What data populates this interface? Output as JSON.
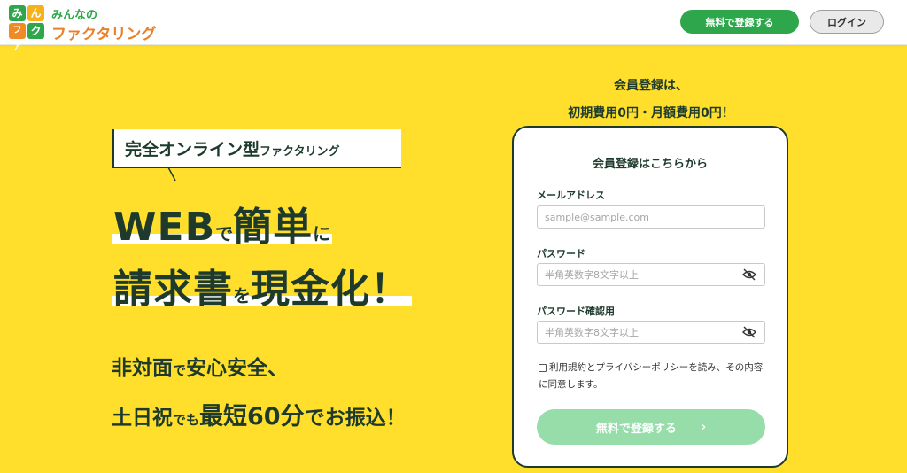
{
  "header": {
    "logo": {
      "tiles": [
        "み",
        "ん",
        "ファ",
        "ク"
      ],
      "small_text": "みんなの",
      "big_text": "ファクタリング"
    },
    "register_button": "無料で登録する",
    "login_button": "ログイン"
  },
  "hero": {
    "badge_main": "完全オンライン型",
    "badge_sub": "ファクタリング",
    "line1": {
      "a": "WEB",
      "b": "で",
      "c": "簡単",
      "d": "に"
    },
    "line2": {
      "a": "請求書",
      "b": "を",
      "c": "現金化！"
    },
    "sub1": {
      "a": "非対面",
      "b": "で",
      "c": "安心安全、"
    },
    "sub2": {
      "a": "土日祝",
      "b": "でも",
      "c": "最短60分",
      "d": "でお振込！"
    }
  },
  "promo": {
    "line1": "会員登録は、",
    "line2": "初期費用0円・月額費用0円！"
  },
  "form": {
    "title": "会員登録はこちらから",
    "email_label": "メールアドレス",
    "email_placeholder": "sample@sample.com",
    "password_label": "パスワード",
    "password_placeholder": "半角英数字8文字以上",
    "confirm_label": "パスワード確認用",
    "confirm_placeholder": "半角英数字8文字以上",
    "consent_text": "利用規約とプライバシーポリシーを読み、その内容に同意します。",
    "submit_label": "無料で登録する",
    "submit_chevron": "›"
  },
  "colors": {
    "background": "#FFDF2B",
    "primary_green": "#2EA74C",
    "disabled_green": "#96DDAA",
    "logo_orange": "#E8812A",
    "text_dark": "#1d3a2c"
  }
}
